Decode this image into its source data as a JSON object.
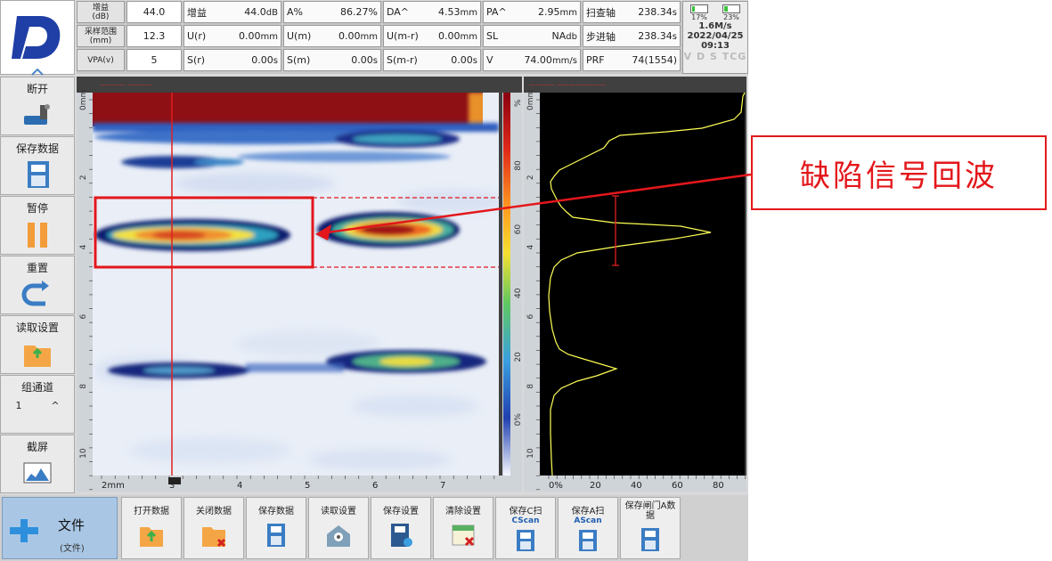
{
  "params": {
    "row1": [
      {
        "label": "增益\n(dB)",
        "value": "44.0"
      },
      {
        "k": "增益",
        "v": "44.0",
        "u": "dB"
      },
      {
        "k": "A%",
        "v": "86.27%",
        "u": ""
      },
      {
        "k": "DA^",
        "v": "4.53",
        "u": "mm"
      },
      {
        "k": "PA^",
        "v": "2.95",
        "u": "mm"
      },
      {
        "k": "扫查轴",
        "v": "238.34",
        "u": "s"
      }
    ],
    "row2": [
      {
        "label": "采样范围\n(mm)",
        "value": "12.3"
      },
      {
        "k": "U(r)",
        "v": "0.00",
        "u": "mm"
      },
      {
        "k": "U(m)",
        "v": "0.00",
        "u": "mm"
      },
      {
        "k": "U(m-r)",
        "v": "0.00",
        "u": "mm"
      },
      {
        "k": "SL",
        "v": "NA",
        "u": "db"
      },
      {
        "k": "步进轴",
        "v": "238.34",
        "u": "s"
      }
    ],
    "row3": [
      {
        "label": "VPA(v)",
        "value": "5"
      },
      {
        "k": "S(r)",
        "v": "0.00",
        "u": "s"
      },
      {
        "k": "S(m)",
        "v": "0.00",
        "u": "s"
      },
      {
        "k": "S(m-r)",
        "v": "0.00",
        "u": "s"
      },
      {
        "k": "V",
        "v": "74.00",
        "u": "mm/s"
      },
      {
        "k": "PRF",
        "v": "74(1554)",
        "u": ""
      }
    ]
  },
  "status": {
    "battery1": "17%",
    "battery2": "23%",
    "battery1_level": 0.17,
    "battery2_level": 0.23,
    "speed": "1.6M/s",
    "date": "2022/04/25",
    "time": "09:13",
    "modes": "V D S TCG"
  },
  "sidebar": [
    {
      "label": "断开",
      "icon": "probe-icon"
    },
    {
      "label": "保存数据",
      "icon": "save-data-icon"
    },
    {
      "label": "暂停",
      "icon": "pause-icon"
    },
    {
      "label": "重置",
      "icon": "reset-icon"
    },
    {
      "label": "读取设置",
      "icon": "folder-read-icon"
    },
    {
      "label": "组通道",
      "icon": "",
      "channel": "1"
    },
    {
      "label": "截屏",
      "icon": "screenshot-icon"
    }
  ],
  "cscan": {
    "y_ticks": [
      "0mm",
      "2",
      "4",
      "6",
      "8",
      "10"
    ],
    "x_ticks": [
      "2mm",
      "3",
      "4",
      "5",
      "6",
      "7"
    ],
    "color_ticks": [
      "%",
      "80",
      "60",
      "40",
      "20",
      "0%"
    ],
    "cursor_label": "2.5"
  },
  "ascan": {
    "y_ticks": [
      "0mm",
      "2",
      "4",
      "6",
      "8",
      "10"
    ],
    "x_ticks": [
      "0%",
      "20",
      "40",
      "60",
      "80"
    ]
  },
  "bottom": {
    "file_label": "文件",
    "file_sub": "(文件)",
    "buttons": [
      {
        "label": "打开数据",
        "icon": "folder-open-icon"
      },
      {
        "label": "关闭数据",
        "icon": "folder-close-icon"
      },
      {
        "label": "保存数据",
        "icon": "save-icon"
      },
      {
        "label": "读取设置",
        "icon": "read-settings-icon"
      },
      {
        "label": "保存设置",
        "icon": "save-settings-icon"
      },
      {
        "label": "清除设置",
        "icon": "clear-settings-icon"
      },
      {
        "label": "保存C扫",
        "icon": "save-cscan-icon",
        "sub": "CScan"
      },
      {
        "label": "保存A扫",
        "icon": "save-ascan-icon",
        "sub": "AScan"
      },
      {
        "label": "保存闸门A数据",
        "icon": "save-gate-icon"
      }
    ]
  },
  "annotation": "缺陷信号回波",
  "colors": {
    "annotation": "#e3171b",
    "ascan_trace": "#ffff55",
    "gate": "#e02020"
  }
}
